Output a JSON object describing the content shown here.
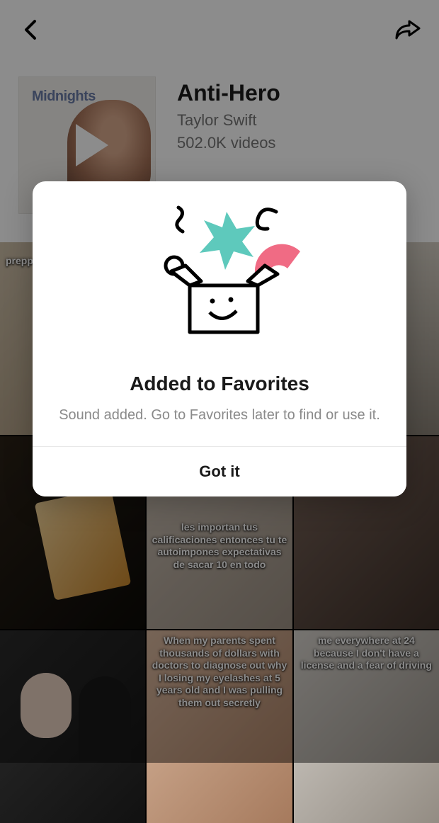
{
  "sound": {
    "title": "Anti-Hero",
    "artist": "Taylor Swift",
    "video_count": "502.0K videos",
    "album_label": "Midnights"
  },
  "modal": {
    "title": "Added to Favorites",
    "description": "Sound added. Go to Favorites later to find or use it.",
    "button": "Got it"
  },
  "videos": [
    {
      "caption": "prepp"
    },
    {
      "caption": ""
    },
    {
      "caption": ""
    },
    {
      "caption": ""
    },
    {
      "caption": "les importan tus calificaciones entonces tu te autoimpones expectativas de sacar 10 en todo"
    },
    {
      "caption": ""
    },
    {
      "caption": ""
    },
    {
      "caption": "When my parents spent thousands of dollars with doctors to diagnose out why I losing my eyelashes at 5 years old and I was pulling them out secretly"
    },
    {
      "caption": "me everywhere at 24 because I don't have a license and a fear of driving"
    }
  ]
}
